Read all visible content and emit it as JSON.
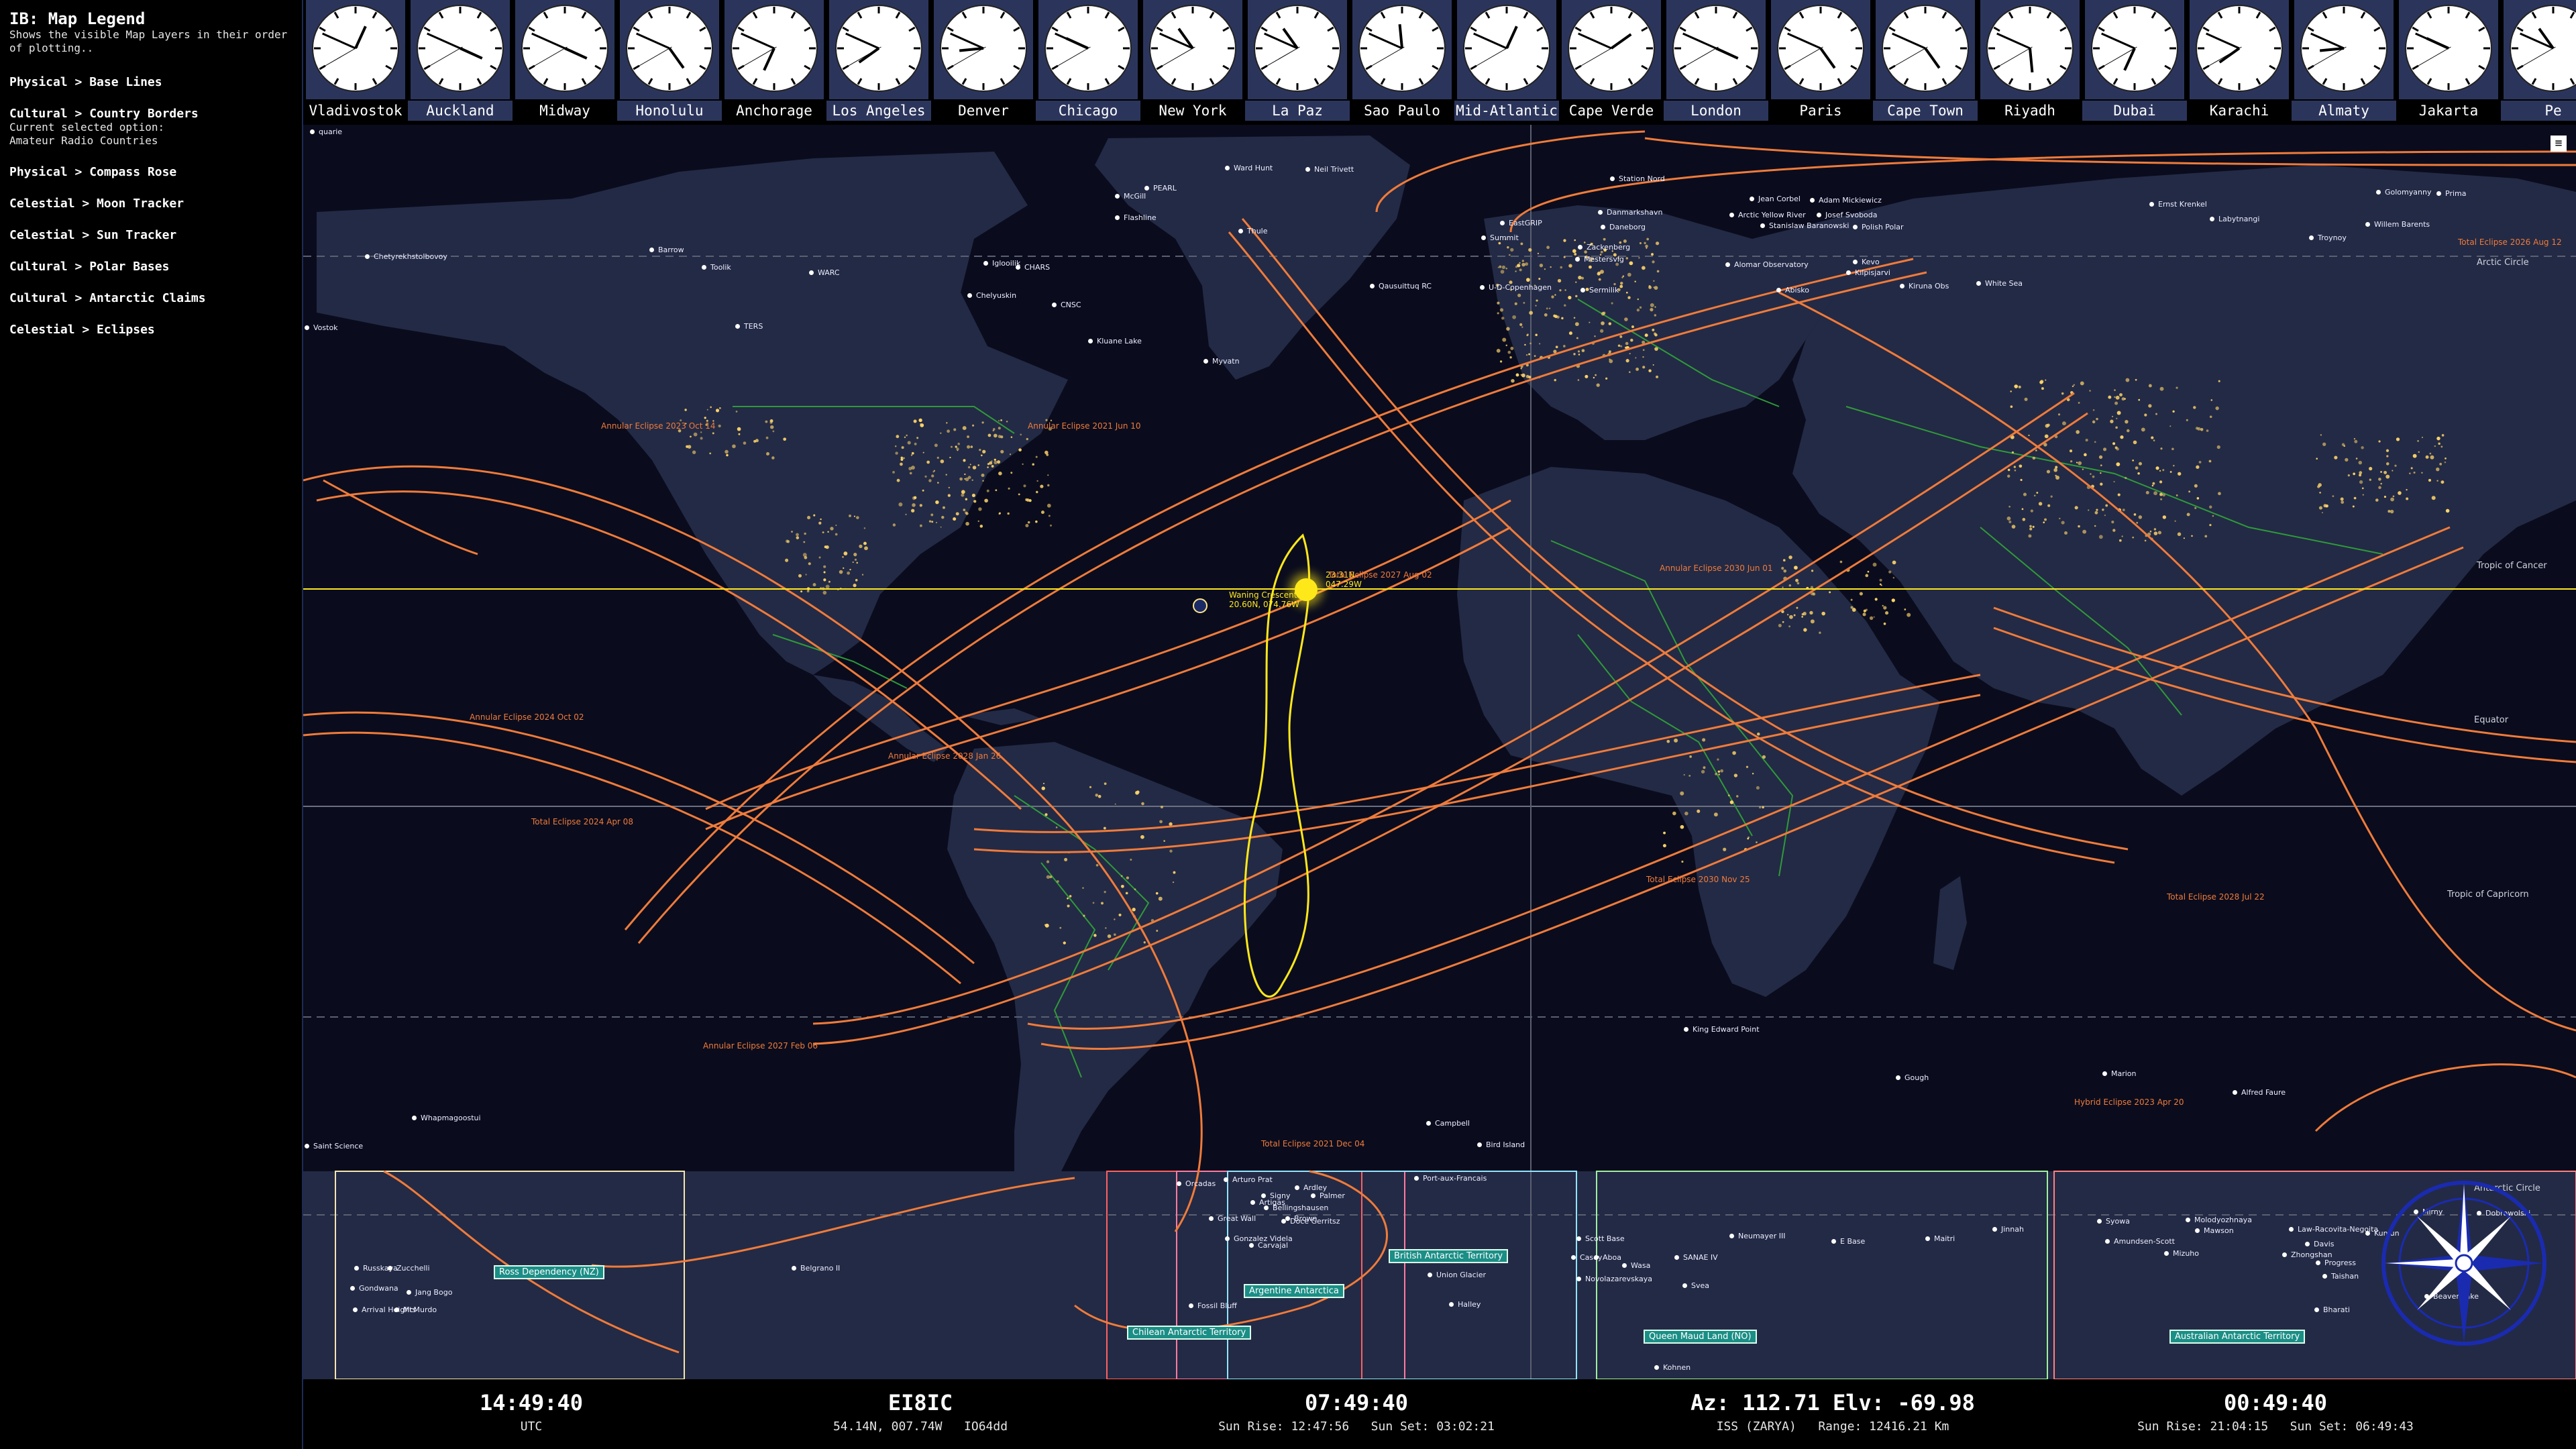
{
  "legend": {
    "title": "IB: Map Legend",
    "description": "Shows the visible Map Layers in their order of plotting..",
    "items": [
      {
        "name": "Physical > Base Lines",
        "sub": ""
      },
      {
        "name": "Cultural > Country Borders",
        "sub": "Current selected option:\nAmateur Radio Countries"
      },
      {
        "name": "Physical > Compass Rose",
        "sub": ""
      },
      {
        "name": "Celestial > Moon Tracker",
        "sub": ""
      },
      {
        "name": "Celestial > Sun Tracker",
        "sub": ""
      },
      {
        "name": "Cultural > Polar Bases",
        "sub": ""
      },
      {
        "name": "Cultural > Antarctic Claims",
        "sub": ""
      },
      {
        "name": "Celestial > Eclipses",
        "sub": ""
      }
    ]
  },
  "clocks": [
    {
      "city": "Vladivostok",
      "h": 0,
      "m": 49,
      "hl": false
    },
    {
      "city": "Auckland",
      "h": 3,
      "m": 49,
      "hl": true
    },
    {
      "city": "Midway",
      "h": 3,
      "m": 49,
      "hl": false
    },
    {
      "city": "Honolulu",
      "h": 4,
      "m": 49,
      "hl": true
    },
    {
      "city": "Anchorage",
      "h": 6,
      "m": 49,
      "hl": false
    },
    {
      "city": "Los Angeles",
      "h": 7,
      "m": 49,
      "hl": true
    },
    {
      "city": "Denver",
      "h": 8,
      "m": 49,
      "hl": false
    },
    {
      "city": "Chicago",
      "h": 9,
      "m": 49,
      "hl": true
    },
    {
      "city": "New York",
      "h": 10,
      "m": 49,
      "hl": false
    },
    {
      "city": "La Paz",
      "h": 10,
      "m": 49,
      "hl": true
    },
    {
      "city": "Sao Paulo",
      "h": 11,
      "m": 49,
      "hl": false
    },
    {
      "city": "Mid-Atlantic",
      "h": 12,
      "m": 49,
      "hl": true
    },
    {
      "city": "Cape Verde",
      "h": 1,
      "m": 49,
      "hl": false
    },
    {
      "city": "London",
      "h": 3,
      "m": 49,
      "hl": true
    },
    {
      "city": "Paris",
      "h": 4,
      "m": 49,
      "hl": false
    },
    {
      "city": "Cape Town",
      "h": 4,
      "m": 49,
      "hl": true
    },
    {
      "city": "Riyadh",
      "h": 5,
      "m": 49,
      "hl": false
    },
    {
      "city": "Dubai",
      "h": 6,
      "m": 49,
      "hl": true
    },
    {
      "city": "Karachi",
      "h": 7,
      "m": 49,
      "hl": false
    },
    {
      "city": "Almaty",
      "h": 8,
      "m": 49,
      "hl": true
    },
    {
      "city": "Jakarta",
      "h": 9,
      "m": 49,
      "hl": false
    },
    {
      "city": "Pe",
      "h": 10,
      "m": 49,
      "hl": true
    }
  ],
  "map": {
    "latitude_labels": [
      "Arctic Circle",
      "Tropic of Cancer",
      "Equator",
      "Tropic of Capricorn",
      "Antarctic Circle"
    ],
    "sun": {
      "label": "23.31N\n047.29W"
    },
    "moon": {
      "label": "Waning Crescent\n20.60N, 074.76W"
    },
    "eclipses": [
      "Annular Eclipse 2023 Oct 14",
      "Annular Eclipse 2021 Jun 10",
      "Total Eclipse 2027 Aug 02",
      "Annular Eclipse 2030 Jun 01",
      "Annular Eclipse 2024 Oct 02",
      "Annular Eclipse 2028 Jan 26",
      "Total Eclipse 2024 Apr 08",
      "Total Eclipse 2030 Nov 25",
      "Total Eclipse 2028 Jul 22",
      "Annular Eclipse 2027 Feb 06",
      "Total Eclipse 2021 Dec 04",
      "Hybrid Eclipse 2023 Apr 20",
      "Total Eclipse 2026 Aug 12"
    ],
    "antarctic_claims": [
      "Ross Dependency (NZ)",
      "Argentine Antarctica",
      "Chilean Antarctic Territory",
      "British Antarctic Territory",
      "Queen Maud Land (NO)",
      "Australian Antarctic Territory"
    ],
    "bases": [
      "Ward Hunt",
      "Neil Trivett",
      "PEARL",
      "McGill",
      "Flashline",
      "Thule",
      "Station Nord",
      "Jean Corbel",
      "Adam Mickiewicz",
      "Arctic Yellow River",
      "Josef Svoboda",
      "Stanislaw Baranowski",
      "Polish Polar",
      "Ernst Krenkel",
      "Golomyanny",
      "Prima",
      "Chetyrekhstolbovoy",
      "Barrow",
      "Toolik",
      "WARC",
      "CHARS",
      "Iglooilik",
      "Danmarkshavn",
      "Daneborg",
      "EastGRIP",
      "Summit",
      "Zackenberg",
      "Mestersvig",
      "Alomar Observatory",
      "Kevo",
      "Kilpisjarvi",
      "Abisko",
      "Kiruna Obs",
      "White Sea",
      "Labytnangi",
      "Troynoy",
      "Willem Barents",
      "Chelyuskin",
      "TERS",
      "Kluane Lake",
      "CNSC",
      "Qausuittuq RC",
      "U-D-Copenhagen",
      "Sermilik",
      "Myvatn",
      "Whapmagoostui",
      "Campbell",
      "Bird Island",
      "King Edward Point",
      "Gough",
      "Marion",
      "Alfred Faure",
      "Port-aux-Francais",
      "Orcadas",
      "Arturo Prat",
      "Ardley",
      "Signy",
      "Palmer",
      "Artigas",
      "Bellingshausen",
      "Great Wall",
      "Doce Gerritsz",
      "Brown",
      "Gonzalez Videla",
      "Carvajal",
      "Fossil Bluff",
      "Union Glacier",
      "Halley",
      "Belgrano II",
      "Russkaya",
      "Zucchelli",
      "Gondwana",
      "Jang Bogo",
      "Arrival Heights",
      "McMurdo",
      "Scott Base",
      "Neumayer III",
      "E Base",
      "Maitri",
      "Jinnah",
      "Syowa",
      "Molodyozhnaya",
      "Mawson",
      "Law-Racovita-Negoita",
      "Davis",
      "Zhongshan",
      "Progress",
      "Taishan",
      "Bharati",
      "Kunlun",
      "Mirny",
      "Dobrowolski",
      "Casey",
      "Aboa",
      "Wasa",
      "SANAE IV",
      "Novolazarevskaya",
      "Svea",
      "Kohnen",
      "Amundsen-Scott",
      "Mizuho",
      "Beaver Lake",
      "Vostok",
      "Saint Science",
      "quarie"
    ]
  },
  "infobar": {
    "utc_time": "14:49:40",
    "utc_label": "UTC",
    "callsign": "EI8IC",
    "location": "54.14N, 007.74W   IO64dd",
    "local_time": "07:49:40",
    "local_sun": "Sun Rise: 12:47:56   Sun Set: 03:02:21",
    "satellite": "Az: 112.71   Elv: -69.98",
    "satellite_info": "ISS (ZARYA)   Range: 12416.21 Km",
    "remote_time": "00:49:40",
    "remote_sun": "Sun Rise: 21:04:15   Sun Set: 06:49:43"
  },
  "colors": {
    "eclipse": "#f07b3a",
    "sun_track": "#ffe81a",
    "ocean": "#0a0c1d",
    "land": "#232a45",
    "border": "#2e9a3a",
    "highlight": "#2b355c"
  }
}
